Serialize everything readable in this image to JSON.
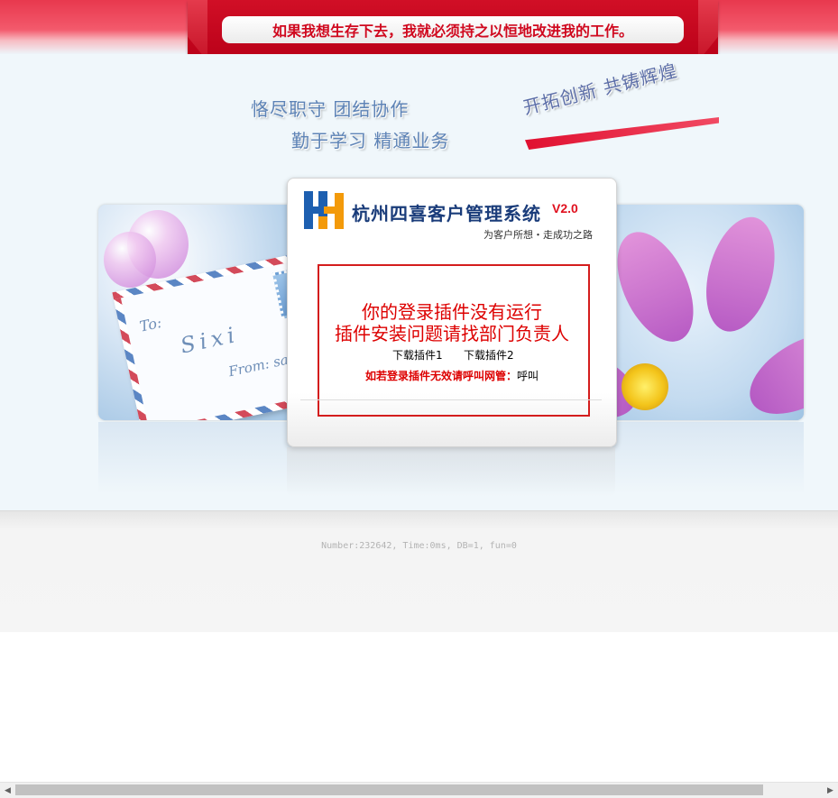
{
  "header": {
    "motto": "如果我想生存下去，我就必须持之以恒地改进我的工作。"
  },
  "slogans": {
    "line1": "恪尽职守  团结协作",
    "line2": "勤于学习  精通业务",
    "line3": "开拓创新  共铸辉煌"
  },
  "envelope": {
    "to": "To:",
    "name": "Sixi",
    "from": "From: sall"
  },
  "login_card": {
    "system_name": "杭州四喜客户管理系统",
    "version": "V2.0",
    "tagline": "为客户所想・走成功之路",
    "notice_line1": "你的登录插件没有运行",
    "notice_line2": "插件安装问题请找部门负责人",
    "download1": "下载插件1",
    "download2": "下载插件2",
    "help_label": "如若登录插件无效请呼叫网管：",
    "help_value": "呼叫"
  },
  "footer": {
    "stats": "Number:232642, Time:0ms, DB=1, fun=0"
  },
  "colors": {
    "brand_red": "#d10f26",
    "slogan_blue": "#5d83b6",
    "notice_red": "#d41d1d"
  }
}
